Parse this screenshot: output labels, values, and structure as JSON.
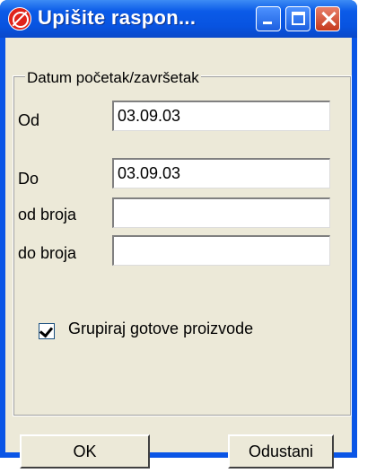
{
  "window": {
    "title": "Upišite raspon...",
    "colors": {
      "titlebar": "#0a55e6",
      "client": "#ece9d8",
      "close": "#c5391c"
    }
  },
  "group": {
    "label": "Datum početak/završetak"
  },
  "fields": {
    "od": {
      "label": "Od",
      "value": "03.09.03"
    },
    "do": {
      "label": "Do",
      "value": "03.09.03"
    },
    "od_broja": {
      "label": "od broja",
      "value": ""
    },
    "do_broja": {
      "label": "do broja",
      "value": ""
    }
  },
  "checkbox": {
    "label": "Grupiraj gotove proizvode",
    "checked": true
  },
  "buttons": {
    "ok": "OK",
    "cancel": "Odustani"
  },
  "icons": {
    "app": "no-entry-icon",
    "minimize": "minimize-icon",
    "maximize": "maximize-icon",
    "close": "close-icon"
  }
}
